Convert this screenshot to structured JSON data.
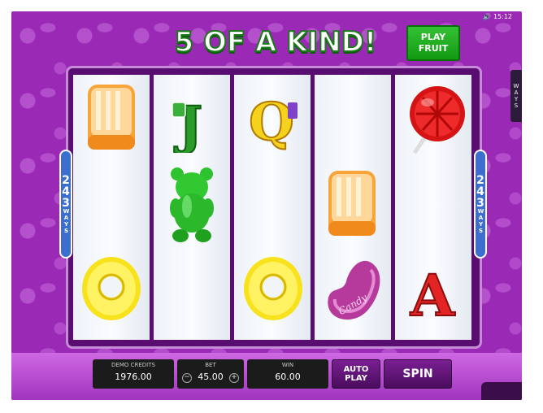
{
  "status_bar": {
    "time": "15:12"
  },
  "title": "5 OF A KIND!",
  "play_fruit_label": "PLAY FRUIT",
  "ways": {
    "count": "243",
    "label": "WAYS"
  },
  "side_tab": "WAYS",
  "reels": [
    [
      "orange-jelly",
      "",
      "yellow-ring"
    ],
    [
      "jack-card",
      "green-gummy-bear",
      ""
    ],
    [
      "queen-card",
      "",
      "yellow-ring"
    ],
    [
      "",
      "orange-jelly",
      "pink-jellybean"
    ],
    [
      "red-lollipop",
      "",
      "ace-card"
    ]
  ],
  "card_letters": {
    "jack": "J",
    "queen": "Q",
    "ace": "A"
  },
  "candy_text": "Candy",
  "controls": {
    "credits": {
      "label": "DEMO CREDITS",
      "value": "1976.00"
    },
    "bet": {
      "label": "BET",
      "value": "45.00",
      "minus": "−",
      "plus": "+"
    },
    "win": {
      "label": "WIN",
      "value": "60.00"
    },
    "autoplay": "AUTO PLAY",
    "spin": "SPIN"
  },
  "colors": {
    "background": "#9a2ab6",
    "title_stroke": "#1a7a1a",
    "play_fruit": "#1fae1f",
    "ways_badge": "#3b6ed0"
  }
}
